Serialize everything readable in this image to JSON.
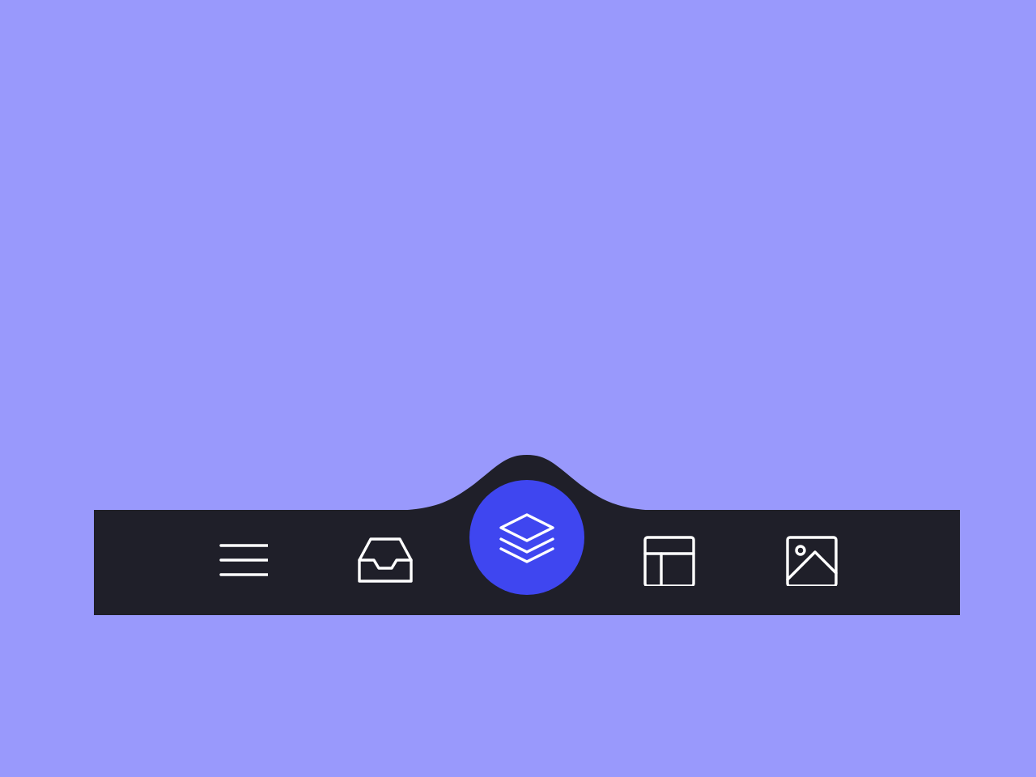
{
  "colors": {
    "background": "#9999fc",
    "navbar": "#1f1f29",
    "active": "#3f46f0",
    "icon": "#ffffff"
  },
  "navbar": {
    "items": [
      {
        "icon": "menu-icon",
        "active": false
      },
      {
        "icon": "inbox-icon",
        "active": false
      },
      {
        "icon": "layers-icon",
        "active": true
      },
      {
        "icon": "layout-icon",
        "active": false
      },
      {
        "icon": "image-icon",
        "active": false
      }
    ]
  }
}
